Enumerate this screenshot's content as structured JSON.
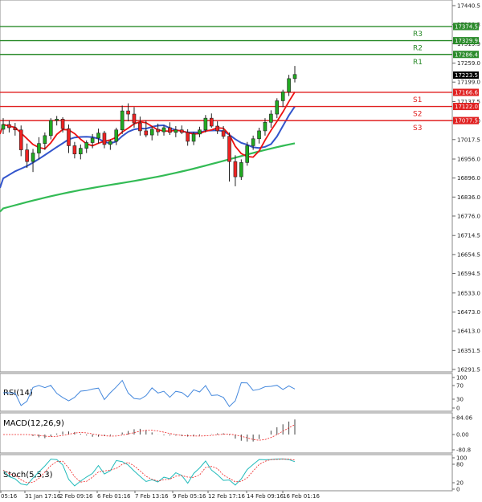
{
  "chart_data": {
    "type": "candlestick",
    "price_axis": {
      "ticks": [
        "17440.5",
        "17380.3",
        "17319.9",
        "17259.0",
        "17199.0",
        "17137.5",
        "17077.0",
        "17017.5",
        "16956.0",
        "16896.0",
        "16836.0",
        "16776.0",
        "16714.5",
        "16654.5",
        "16594.5",
        "16533.0",
        "16473.0",
        "16413.0",
        "16351.5",
        "16291.5"
      ],
      "ylim": [
        16280,
        17445
      ],
      "current_price": "17223.5"
    },
    "time_axis": {
      "ticks": [
        "05:16",
        "31 Jan 17:16",
        "2 Feb 09:16",
        "6 Feb 01:16",
        "7 Feb 13:16",
        "9 Feb 05:16",
        "12 Feb 17:16",
        "14 Feb 09:16",
        "16 Feb 01:16"
      ]
    },
    "levels": [
      {
        "name": "R3",
        "value": 17374.5,
        "label": "17374.5",
        "color": "#2a8a2a"
      },
      {
        "name": "R2",
        "value": 17329.9,
        "label": "17329.9",
        "color": "#2a8a2a"
      },
      {
        "name": "R1",
        "value": 17286.4,
        "label": "17286.4",
        "color": "#2a8a2a"
      },
      {
        "name": "S1",
        "value": 17166.6,
        "label": "17166.6",
        "color": "#e02020"
      },
      {
        "name": "S2",
        "value": 17122.0,
        "label": "17122.0",
        "color": "#e02020"
      },
      {
        "name": "S3",
        "value": 17077.5,
        "label": "17077.5",
        "color": "#e02020"
      }
    ],
    "candles": [
      {
        "o": 17050,
        "h": 17085,
        "l": 17035,
        "c": 17065
      },
      {
        "o": 17065,
        "h": 17078,
        "l": 17040,
        "c": 17055
      },
      {
        "o": 17055,
        "h": 17070,
        "l": 17030,
        "c": 17048
      },
      {
        "o": 17048,
        "h": 17062,
        "l": 16965,
        "c": 16985
      },
      {
        "o": 16985,
        "h": 17005,
        "l": 16928,
        "c": 16948
      },
      {
        "o": 16948,
        "h": 16988,
        "l": 16915,
        "c": 16975
      },
      {
        "o": 16975,
        "h": 17025,
        "l": 16955,
        "c": 17005
      },
      {
        "o": 17005,
        "h": 17040,
        "l": 16985,
        "c": 17030
      },
      {
        "o": 17030,
        "h": 17085,
        "l": 17018,
        "c": 17078
      },
      {
        "o": 17078,
        "h": 17092,
        "l": 17062,
        "c": 17082
      },
      {
        "o": 17082,
        "h": 17088,
        "l": 17040,
        "c": 17052
      },
      {
        "o": 17052,
        "h": 17065,
        "l": 16975,
        "c": 16998
      },
      {
        "o": 16998,
        "h": 17010,
        "l": 16958,
        "c": 16972
      },
      {
        "o": 16972,
        "h": 17002,
        "l": 16955,
        "c": 16990
      },
      {
        "o": 16990,
        "h": 17015,
        "l": 16975,
        "c": 17008
      },
      {
        "o": 17008,
        "h": 17035,
        "l": 16990,
        "c": 17022
      },
      {
        "o": 17022,
        "h": 17052,
        "l": 17005,
        "c": 17038
      },
      {
        "o": 17038,
        "h": 17045,
        "l": 16990,
        "c": 17002
      },
      {
        "o": 17002,
        "h": 17018,
        "l": 16985,
        "c": 17012
      },
      {
        "o": 17012,
        "h": 17055,
        "l": 17000,
        "c": 17048
      },
      {
        "o": 17048,
        "h": 17125,
        "l": 17035,
        "c": 17108
      },
      {
        "o": 17108,
        "h": 17132,
        "l": 17075,
        "c": 17098
      },
      {
        "o": 17098,
        "h": 17120,
        "l": 17055,
        "c": 17070
      },
      {
        "o": 17070,
        "h": 17090,
        "l": 17030,
        "c": 17045
      },
      {
        "o": 17045,
        "h": 17078,
        "l": 17025,
        "c": 17032
      },
      {
        "o": 17032,
        "h": 17060,
        "l": 17015,
        "c": 17050
      },
      {
        "o": 17050,
        "h": 17068,
        "l": 17030,
        "c": 17042
      },
      {
        "o": 17042,
        "h": 17062,
        "l": 17030,
        "c": 17055
      },
      {
        "o": 17055,
        "h": 17072,
        "l": 17032,
        "c": 17040
      },
      {
        "o": 17040,
        "h": 17060,
        "l": 17025,
        "c": 17048
      },
      {
        "o": 17048,
        "h": 17062,
        "l": 17035,
        "c": 17040
      },
      {
        "o": 17040,
        "h": 17050,
        "l": 16998,
        "c": 17012
      },
      {
        "o": 17012,
        "h": 17042,
        "l": 17000,
        "c": 17035
      },
      {
        "o": 17035,
        "h": 17058,
        "l": 17025,
        "c": 17048
      },
      {
        "o": 17048,
        "h": 17095,
        "l": 17040,
        "c": 17085
      },
      {
        "o": 17085,
        "h": 17100,
        "l": 17055,
        "c": 17060
      },
      {
        "o": 17060,
        "h": 17075,
        "l": 17035,
        "c": 17045
      },
      {
        "o": 17045,
        "h": 17060,
        "l": 17020,
        "c": 17028
      },
      {
        "o": 17028,
        "h": 17040,
        "l": 16885,
        "c": 16948
      },
      {
        "o": 16948,
        "h": 16968,
        "l": 16870,
        "c": 16900
      },
      {
        "o": 16900,
        "h": 16955,
        "l": 16890,
        "c": 16945
      },
      {
        "o": 16945,
        "h": 17010,
        "l": 16935,
        "c": 16998
      },
      {
        "o": 16998,
        "h": 17030,
        "l": 16985,
        "c": 17020
      },
      {
        "o": 17020,
        "h": 17055,
        "l": 17005,
        "c": 17045
      },
      {
        "o": 17045,
        "h": 17085,
        "l": 17030,
        "c": 17072
      },
      {
        "o": 17072,
        "h": 17110,
        "l": 17055,
        "c": 17098
      },
      {
        "o": 17098,
        "h": 17148,
        "l": 17085,
        "c": 17140
      },
      {
        "o": 17140,
        "h": 17175,
        "l": 17120,
        "c": 17168
      },
      {
        "o": 17168,
        "h": 17222,
        "l": 17155,
        "c": 17210
      },
      {
        "o": 17210,
        "h": 17250,
        "l": 17198,
        "c": 17223
      }
    ]
  },
  "indicators": {
    "rsi": {
      "label": "RSI(14)",
      "ticks": [
        "100",
        "70",
        "30",
        "0"
      ]
    },
    "macd": {
      "label": "MACD(12,26,9)",
      "ticks": [
        "84.06",
        "0.00",
        "-80.8"
      ]
    },
    "stoch": {
      "label": "Stoch(5,5,3)",
      "ticks": [
        "100",
        "80",
        "20",
        "0"
      ]
    }
  },
  "colors": {
    "bull": "#22aa22",
    "bear": "#ee2222",
    "ma_fast": "#ee1111",
    "ma_mid": "#3355cc",
    "ma_slow": "#33bb55",
    "rsi_line": "#4488dd",
    "macd_hist": "#444444",
    "macd_signal": "#ee2222",
    "stoch_main": "#22bbbb",
    "stoch_signal": "#ee2222"
  }
}
